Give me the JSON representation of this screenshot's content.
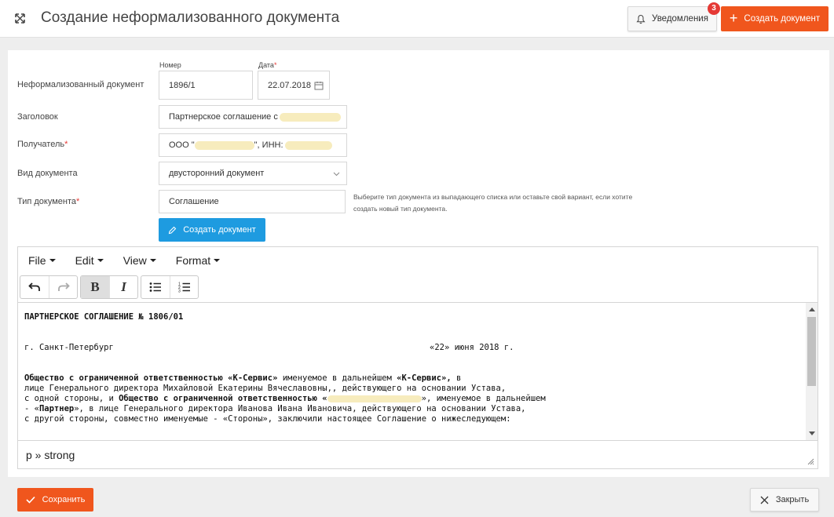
{
  "header": {
    "title": "Создание неформализованного документа",
    "notifications_label": "Уведомления",
    "notifications_count": "3",
    "create_document_label": "Создать документ"
  },
  "form": {
    "doc_label": "Неформализованный документ",
    "number_label": "Номер",
    "number_value": "1896/1",
    "date_label": "Дата",
    "date_required": "*",
    "date_value": "22.07.2018",
    "heading_label": "Заголовок",
    "heading_value": "Партнерское соглашение с",
    "recipient_label": "Получатель",
    "recipient_required": "*",
    "recipient_prefix": "ООО \"",
    "recipient_mid": "\", ИНН:",
    "doc_kind_label": "Вид документа",
    "doc_kind_value": "двусторонний документ",
    "doc_type_label": "Тип документа",
    "doc_type_required": "*",
    "doc_type_value": "Соглашение",
    "doc_type_hint": "Выберите тип документа из выпадающего списка или оставьте свой вариант, если хотите создать новый тип документа.",
    "create_doc_button": "Создать документ"
  },
  "editor": {
    "menu": [
      "File",
      "Edit",
      "View",
      "Format"
    ],
    "toolbar": {
      "undo": "undo-icon",
      "redo": "redo-icon",
      "bold": "B",
      "italic": "I",
      "bullet_list": "bullet-list-icon",
      "numbered_list": "numbered-list-icon"
    },
    "content": {
      "title": "ПАРТНЕРСКОЕ СОГЛАШЕНИЕ № 1806/01",
      "city": "г. Санкт-Петербург",
      "date": "«22» июня 2018 г.",
      "p1_bold1": "Общество с ограниченной ответственностью «К-Сервис»",
      "p1_text1": " именуемое в дальнейшем ",
      "p1_bold2": "«К-Сервис»,",
      "p1_text2": " в",
      "line2": "лице Генерального директора Михайловой Екатерины Вячеславовны,, действующего на основании Устава,",
      "line3_text1": "с одной стороны, и ",
      "line3_bold": "Общество с ограниченной ответственностью «",
      "line3_text2": "», именуемое в дальнейшем",
      "line4_text1": "- «",
      "line4_bold": "Партнер",
      "line4_text2": "», в лице Генерального директора Иванова Ивана Ивановича, действующего на основании Устава,",
      "line5": "с другой стороны, совместно именуемые - «Стороны», заключили настоящее Соглашение о нижеследующем:"
    },
    "status_path": "p » strong"
  },
  "footer": {
    "save_label": "Сохранить",
    "close_label": "Закрыть"
  }
}
